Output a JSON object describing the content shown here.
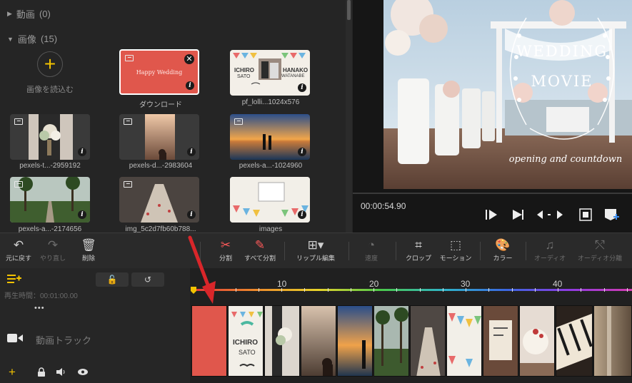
{
  "library": {
    "video_section": {
      "label": "動画",
      "count": "(0)"
    },
    "image_section": {
      "label": "画像",
      "count": "(15)"
    },
    "import_label": "画像を読込む",
    "items": [
      {
        "caption": "ダウンロード",
        "overlay_text": "Happy Wedding"
      },
      {
        "caption": "pf_lolli...1024x576"
      },
      {
        "caption": "pexels-t...-2959192"
      },
      {
        "caption": "pexels-d...-2983604"
      },
      {
        "caption": "pexels-a...-1024960"
      },
      {
        "caption": "pexels-a...-2174656"
      },
      {
        "caption": "img_5c2d7fb60b788..."
      },
      {
        "caption": "images"
      }
    ],
    "pf_card": {
      "left_name": "ICHIRO",
      "left_sub": "SATO",
      "right_name": "HANAKO",
      "right_sub": "WATANABE"
    }
  },
  "preview": {
    "title_line1": "WEDDING",
    "title_line2": "MOVIE",
    "subtitle": "opening and countdown",
    "timecode": "00:00:54.90"
  },
  "toolbar": {
    "undo": "元に戻す",
    "redo": "やり直し",
    "delete": "削除",
    "split": "分割",
    "split_all": "すべて分割",
    "ripple": "リップル編集",
    "speed": "速度",
    "crop": "クロップ",
    "motion": "モーション",
    "color": "カラー",
    "audio": "オーディオ",
    "audio_split": "オーディオ分離"
  },
  "timeline": {
    "playtime": "再生時間：00:01:00.00",
    "track_name": "動画トラック",
    "more": "•••",
    "ruler_ticks": [
      "10",
      "20",
      "30",
      "40"
    ],
    "clip_text": {
      "name": "ICHIRO",
      "sub": "SATO"
    }
  },
  "colors": {
    "accent": "#f2c200",
    "split_red": "#ff5a5a",
    "selected_clip": "#e0574c",
    "arrow": "#d9262a"
  },
  "icons": [
    "add-track-icon",
    "lock-icon",
    "loop-icon",
    "video-track-icon",
    "add-icon",
    "mute-icon",
    "eye-icon",
    "play-icon",
    "undo-icon",
    "redo-icon",
    "trash-icon",
    "scissors-icon",
    "crop-icon",
    "palette-icon"
  ]
}
